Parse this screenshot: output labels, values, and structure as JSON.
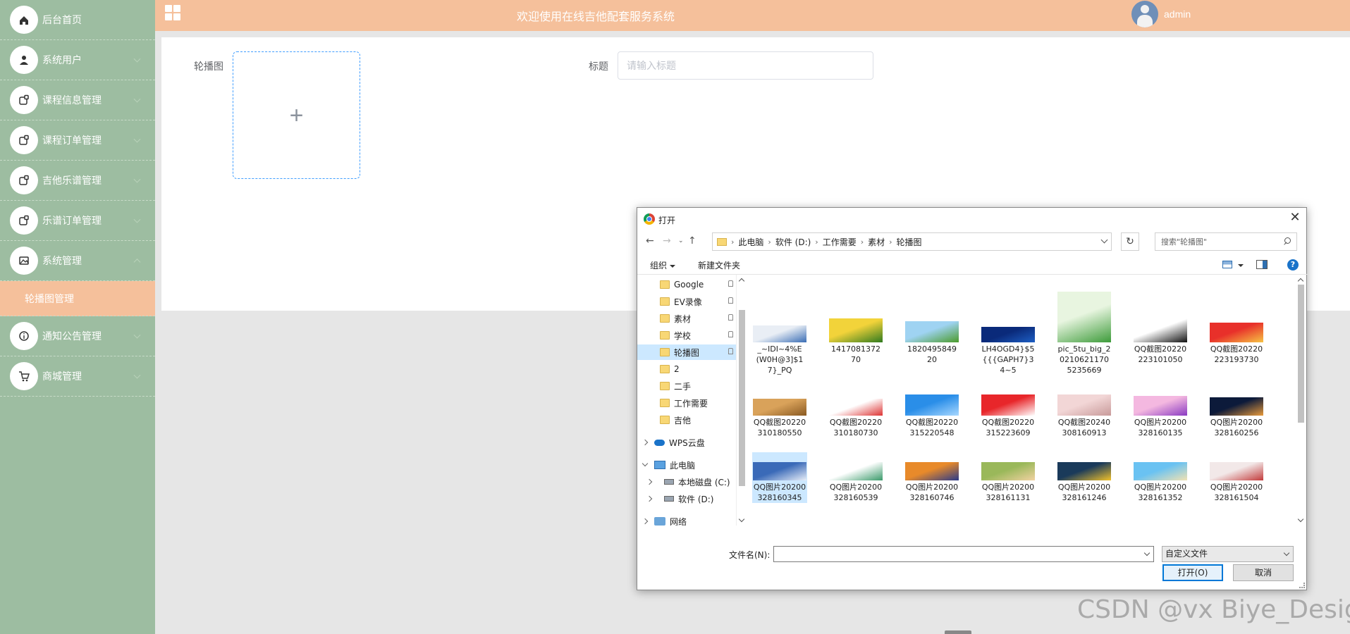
{
  "topbar": {
    "title": "欢迎使用在线吉他配套服务系统",
    "user": "admin"
  },
  "sidebar": {
    "items": [
      {
        "label": "后台首页",
        "icon": "home-icon",
        "chevron": false
      },
      {
        "label": "系统用户",
        "icon": "user-icon",
        "chevron": true
      },
      {
        "label": "课程信息管理",
        "icon": "module-icon",
        "chevron": true
      },
      {
        "label": "课程订单管理",
        "icon": "module-icon",
        "chevron": true
      },
      {
        "label": "吉他乐谱管理",
        "icon": "module-icon",
        "chevron": true
      },
      {
        "label": "乐谱订单管理",
        "icon": "module-icon",
        "chevron": true
      },
      {
        "label": "系统管理",
        "icon": "image-icon",
        "chevron": true,
        "expanded": true
      }
    ],
    "subitem": "轮播图管理",
    "items_after": [
      {
        "label": "通知公告管理",
        "icon": "info-icon",
        "chevron": true
      },
      {
        "label": "商城管理",
        "icon": "cart-icon",
        "chevron": true
      }
    ]
  },
  "form": {
    "carousel_label": "轮播图",
    "upload_plus": "+",
    "title_label": "标题",
    "title_placeholder": "请输入标题",
    "title_value": ""
  },
  "dialog": {
    "title": "打开",
    "close": "✕",
    "breadcrumb": [
      "此电脑",
      "软件 (D:)",
      "工作需要",
      "素材",
      "轮播图"
    ],
    "search_placeholder": "搜索\"轮播图\"",
    "organize": "组织",
    "new_folder": "新建文件夹",
    "tree": [
      {
        "label": "Google",
        "type": "folder",
        "pinned": true
      },
      {
        "label": "EV录像",
        "type": "folder",
        "pinned": true
      },
      {
        "label": "素材",
        "type": "folder",
        "pinned": true
      },
      {
        "label": "学校",
        "type": "folder",
        "pinned": true
      },
      {
        "label": "轮播图",
        "type": "folder",
        "pinned": true,
        "selected": true
      },
      {
        "label": "2",
        "type": "folder"
      },
      {
        "label": "二手",
        "type": "folder"
      },
      {
        "label": "工作需要",
        "type": "folder"
      },
      {
        "label": "吉他",
        "type": "folder"
      },
      {
        "label": "WPS云盘",
        "type": "cloud"
      },
      {
        "label": "此电脑",
        "type": "pc"
      },
      {
        "label": "本地磁盘 (C:)",
        "type": "drive"
      },
      {
        "label": "软件 (D:)",
        "type": "drive"
      },
      {
        "label": "网络",
        "type": "net"
      }
    ],
    "files": [
      {
        "name": "_~IDI~4%E(W0H@3]$17}_PQ",
        "colors": [
          "#e9eef5",
          "#3a6db5"
        ]
      },
      {
        "name": "141708137270",
        "colors": [
          "#f2d33a",
          "#2f7a1f"
        ]
      },
      {
        "name": "182049584920",
        "colors": [
          "#9fd3f2",
          "#4a9a2a"
        ]
      },
      {
        "name": "LH4OGD4}$5{{{GAPH7}34~5",
        "colors": [
          "#0a2a7a",
          "#1e5fc4"
        ]
      },
      {
        "name": "pic_5tu_big_202106211705235669",
        "colors": [
          "#e8f5e0",
          "#3d9b3a"
        ]
      },
      {
        "name": "QQ截图20220223101050",
        "colors": [
          "#ffffff",
          "#111111"
        ]
      },
      {
        "name": "QQ截图20220223193730",
        "colors": [
          "#e8302a",
          "#f6c344"
        ]
      },
      {
        "name": "QQ截图20220310180550",
        "colors": [
          "#d9a25a",
          "#8a5a22"
        ]
      },
      {
        "name": "QQ截图20220310180730",
        "colors": [
          "#ffffff",
          "#d33"
        ]
      },
      {
        "name": "QQ截图20220315220548",
        "colors": [
          "#2a8ee8",
          "#a8d8ff"
        ]
      },
      {
        "name": "QQ截图20220315223609",
        "colors": [
          "#e8262a",
          "#ffffff"
        ]
      },
      {
        "name": "QQ截图20240308160913",
        "colors": [
          "#f2d6d6",
          "#c89a9a"
        ]
      },
      {
        "name": "QQ图片20200328160135",
        "colors": [
          "#f4b8e0",
          "#8a3ac2"
        ]
      },
      {
        "name": "QQ图片20200328160256",
        "colors": [
          "#0c1a3a",
          "#e89a3a"
        ]
      },
      {
        "name": "QQ图片20200328160345",
        "colors": [
          "#3a6ab8",
          "#e8eef8"
        ],
        "selected": true
      },
      {
        "name": "QQ图片20200328160539",
        "colors": [
          "#ffffff",
          "#3a9a6a"
        ]
      },
      {
        "name": "QQ图片20200328160746",
        "colors": [
          "#e88a2a",
          "#2a3a8a"
        ]
      },
      {
        "name": "QQ图片20200328161131",
        "colors": [
          "#9ab85a",
          "#f2d2a2"
        ]
      },
      {
        "name": "QQ图片20200328161246",
        "colors": [
          "#1a3a5a",
          "#f2c22a"
        ]
      },
      {
        "name": "QQ图片20200328161352",
        "colors": [
          "#6ac2f2",
          "#f2e2b2"
        ]
      },
      {
        "name": "QQ图片20200328161504",
        "colors": [
          "#f2e8e8",
          "#c23a3a"
        ]
      }
    ],
    "filename_label": "文件名(N):",
    "filename_value": "",
    "filetype": "自定义文件",
    "open_btn": "打开(O)",
    "cancel_btn": "取消"
  },
  "watermark": "CSDN @vx Biye_Design"
}
